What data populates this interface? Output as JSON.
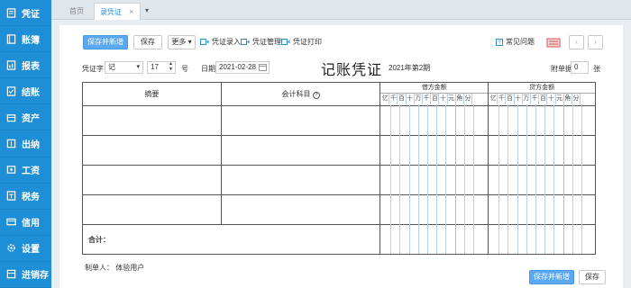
{
  "sidebar": {
    "items": [
      {
        "label": "凭证",
        "icon": "voucher-icon"
      },
      {
        "label": "账簿",
        "icon": "ledger-icon"
      },
      {
        "label": "报表",
        "icon": "report-icon"
      },
      {
        "label": "结账",
        "icon": "closing-icon"
      },
      {
        "label": "资产",
        "icon": "asset-icon"
      },
      {
        "label": "出纳",
        "icon": "cashier-icon"
      },
      {
        "label": "工资",
        "icon": "payroll-icon"
      },
      {
        "label": "税务",
        "icon": "tax-icon"
      },
      {
        "label": "信用",
        "icon": "credit-icon"
      },
      {
        "label": "设置",
        "icon": "gear-icon"
      },
      {
        "label": "进销存",
        "icon": "inventory-icon"
      }
    ]
  },
  "tabs": {
    "home": "首页",
    "active": "录凭证",
    "close": "×",
    "dropdown": "▾"
  },
  "toolbar": {
    "save_new": "保存并新增",
    "save": "保存",
    "more": "更多",
    "more_arrow": "▾",
    "voucher_entry": "凭证录入",
    "voucher_manage": "凭证管理",
    "voucher_print": "凭证打印",
    "faq": "常见问题",
    "prev": "‹",
    "next": "›"
  },
  "form": {
    "voucher_word_label": "凭证字",
    "voucher_word_value": "记",
    "number_value": "17",
    "number_suffix": "号",
    "date_label": "日期",
    "date_value": "2021-02-28",
    "title": "记账凭证",
    "period": "2021年第2期",
    "attachments_label": "附单据",
    "attachments_value": "0",
    "attachments_suffix": "张"
  },
  "table": {
    "col_summary": "摘要",
    "col_account": "会计科目",
    "col_debit": "借方金额",
    "col_credit": "贷方金额",
    "digits": [
      "亿",
      "千",
      "百",
      "十",
      "万",
      "千",
      "百",
      "十",
      "元",
      "角",
      "分"
    ],
    "total_label": "合计："
  },
  "footer": {
    "maker_label": "制单人：",
    "maker_value": "体验用户",
    "save_new": "保存并新增",
    "save": "保存"
  },
  "colors": {
    "sidebar": "#1e8fd6",
    "primary": "#5aa8ef",
    "tab_active_text": "#2b8fd6"
  }
}
